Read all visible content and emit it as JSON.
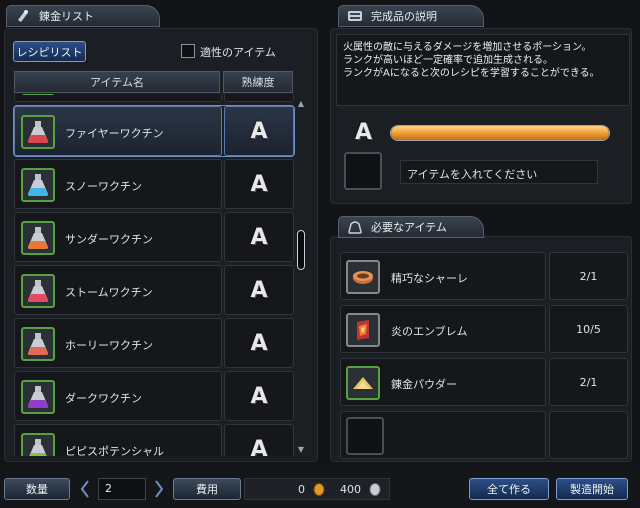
{
  "left_panel": {
    "title": "錬金リスト",
    "recipe_list_button": "レシピリスト",
    "suitable_items_label": "適性のアイテム",
    "column_item_name": "アイテム名",
    "column_proficiency": "熟練度",
    "items": [
      {
        "name": "ファイヤーワクチン",
        "rank": "A",
        "potion_color": "#d8464e"
      },
      {
        "name": "スノーワクチン",
        "rank": "A",
        "potion_color": "#3fb7e6"
      },
      {
        "name": "サンダーワクチン",
        "rank": "A",
        "potion_color": "#e7783a"
      },
      {
        "name": "ストームワクチン",
        "rank": "A",
        "potion_color": "#e34b63"
      },
      {
        "name": "ホーリーワクチン",
        "rank": "A",
        "potion_color": "#e36a52"
      },
      {
        "name": "ダークワクチン",
        "rank": "A",
        "potion_color": "#8f3cc8"
      },
      {
        "name": "ピピスポテンシャル",
        "rank": "A",
        "potion_color": "#7fc447"
      }
    ]
  },
  "description_panel": {
    "title": "完成品の説明",
    "lines": [
      "火属性の敵に与えるダメージを増加させるポーション。",
      "ランクが高いほど一定確率で追加生成される。",
      "ランクがAになると次のレシピを学習することができる。"
    ],
    "rank": "A",
    "progress": 1.0,
    "slot_placeholder": "アイテムを入れてください"
  },
  "required_panel": {
    "title": "必要なアイテム",
    "items": [
      {
        "name": "精巧なシャーレ",
        "count": "2/1"
      },
      {
        "name": "炎のエンブレム",
        "count": "10/5"
      },
      {
        "name": "錬金パウダー",
        "count": "2/1"
      },
      {
        "name": "",
        "count": ""
      }
    ]
  },
  "bottom_bar": {
    "quantity_label": "数量",
    "quantity_value": "2",
    "cost_label": "費用",
    "cost_gold": "0",
    "cost_silver": "400",
    "make_all_button": "全て作る",
    "start_button": "製造開始"
  },
  "colors": {
    "accent_blue": "#2d4f86",
    "selection_border": "#6b8fc9",
    "icon_frame_green": "#55a23e",
    "progress_orange": "#f0a43a"
  }
}
